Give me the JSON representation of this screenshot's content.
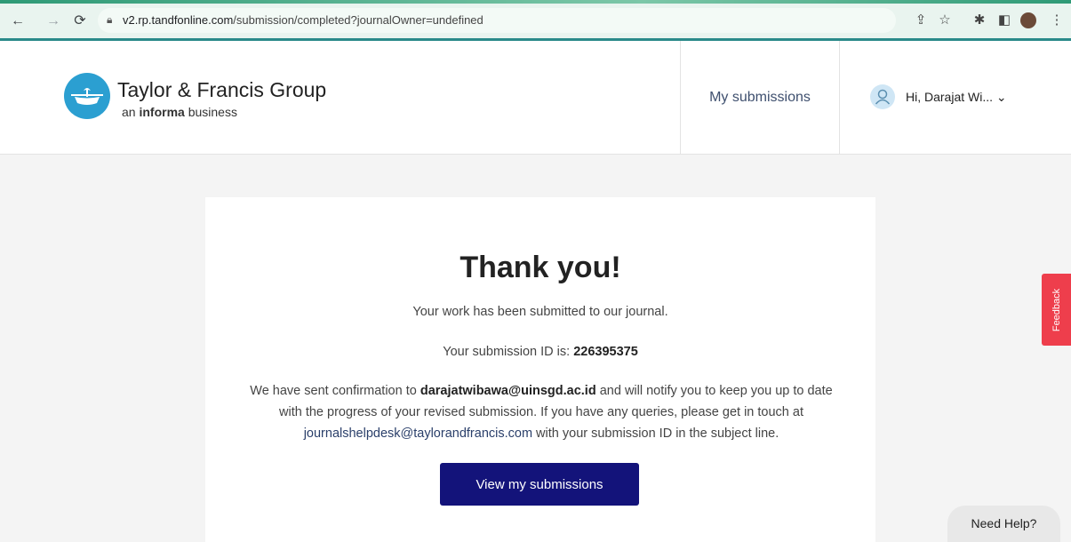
{
  "browser": {
    "url_host": "v2.rp.tandfonline.com",
    "url_path": "/submission/completed?journalOwner=undefined"
  },
  "header": {
    "brand_name": "Taylor & Francis Group",
    "brand_tag_prefix": "an ",
    "brand_tag_bold": "informa",
    "brand_tag_suffix": " business",
    "my_submissions": "My submissions",
    "user_greeting": "Hi, Darajat Wi...",
    "user_chevron": "⌄"
  },
  "main": {
    "title": "Thank you!",
    "line1": "Your work has been submitted to our journal.",
    "id_label": "Your submission ID is: ",
    "id_value": "226395375",
    "para_a": "We have sent confirmation to ",
    "email": "darajatwibawa@uinsgd.ac.id",
    "para_b": " and will notify you to keep you up to date with the progress of your revised submission. If you have any queries, please get in touch at ",
    "help_email": "journalshelpdesk@taylorandfrancis.com",
    "para_c": " with your submission ID in the subject line.",
    "button_label": "View my submissions"
  },
  "widgets": {
    "feedback": "Feedback",
    "need_help": "Need Help?"
  },
  "colors": {
    "primary_button": "#13137a",
    "feedback_tab": "#ee3e4c",
    "logo_blue": "#2b9fd1"
  }
}
